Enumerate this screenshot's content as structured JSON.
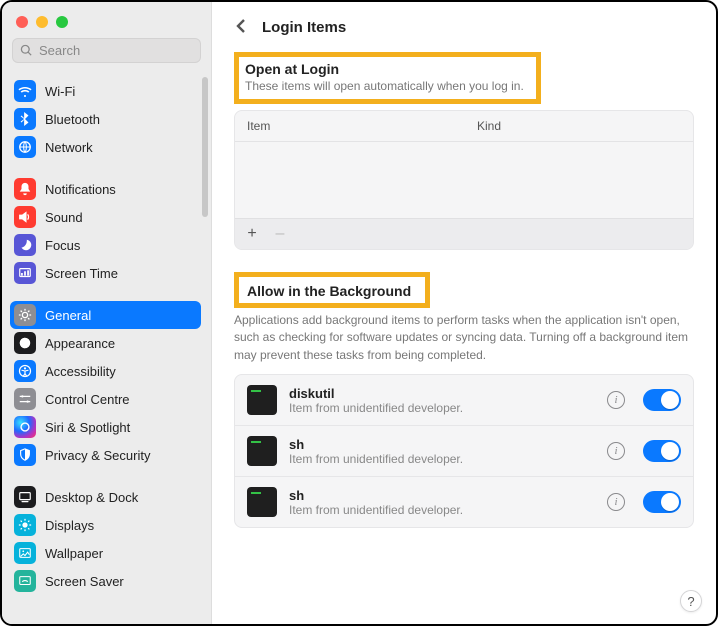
{
  "search": {
    "placeholder": "Search"
  },
  "header": {
    "title": "Login Items"
  },
  "open_at_login": {
    "title": "Open at Login",
    "subtitle": "These items will open automatically when you log in.",
    "columns": {
      "item": "Item",
      "kind": "Kind"
    },
    "add": "+",
    "remove": "–"
  },
  "allow_bg": {
    "title": "Allow in the Background",
    "subtitle": "Applications add background items to perform tasks when the application isn't open, such as checking for software updates or syncing data. Turning off a background item may prevent these tasks from being completed.",
    "items": [
      {
        "name": "diskutil",
        "sub": "Item from unidentified developer."
      },
      {
        "name": "sh",
        "sub": "Item from unidentified developer."
      },
      {
        "name": "sh",
        "sub": "Item from unidentified developer."
      }
    ]
  },
  "help": {
    "label": "?"
  },
  "sidebar": {
    "groups": [
      [
        {
          "label": "Wi-Fi",
          "style": "ic-blue",
          "name": "wifi"
        },
        {
          "label": "Bluetooth",
          "style": "ic-blue",
          "name": "bluetooth"
        },
        {
          "label": "Network",
          "style": "ic-blue",
          "name": "network"
        }
      ],
      [
        {
          "label": "Notifications",
          "style": "ic-red",
          "name": "notifications"
        },
        {
          "label": "Sound",
          "style": "ic-red",
          "name": "sound"
        },
        {
          "label": "Focus",
          "style": "ic-indigo",
          "name": "focus"
        },
        {
          "label": "Screen Time",
          "style": "ic-indigo",
          "name": "screen-time"
        }
      ],
      [
        {
          "label": "General",
          "style": "ic-gray",
          "name": "general",
          "selected": true
        },
        {
          "label": "Appearance",
          "style": "ic-black",
          "name": "appearance"
        },
        {
          "label": "Accessibility",
          "style": "ic-blue",
          "name": "accessibility"
        },
        {
          "label": "Control Centre",
          "style": "ic-gray",
          "name": "control-centre"
        },
        {
          "label": "Siri & Spotlight",
          "style": "ic-siri",
          "name": "siri-spotlight"
        },
        {
          "label": "Privacy & Security",
          "style": "ic-blue",
          "name": "privacy-security"
        }
      ],
      [
        {
          "label": "Desktop & Dock",
          "style": "ic-black",
          "name": "desktop-dock"
        },
        {
          "label": "Displays",
          "style": "ic-cyan",
          "name": "displays"
        },
        {
          "label": "Wallpaper",
          "style": "ic-cyan",
          "name": "wallpaper"
        },
        {
          "label": "Screen Saver",
          "style": "ic-teal",
          "name": "screen-saver"
        }
      ]
    ]
  }
}
